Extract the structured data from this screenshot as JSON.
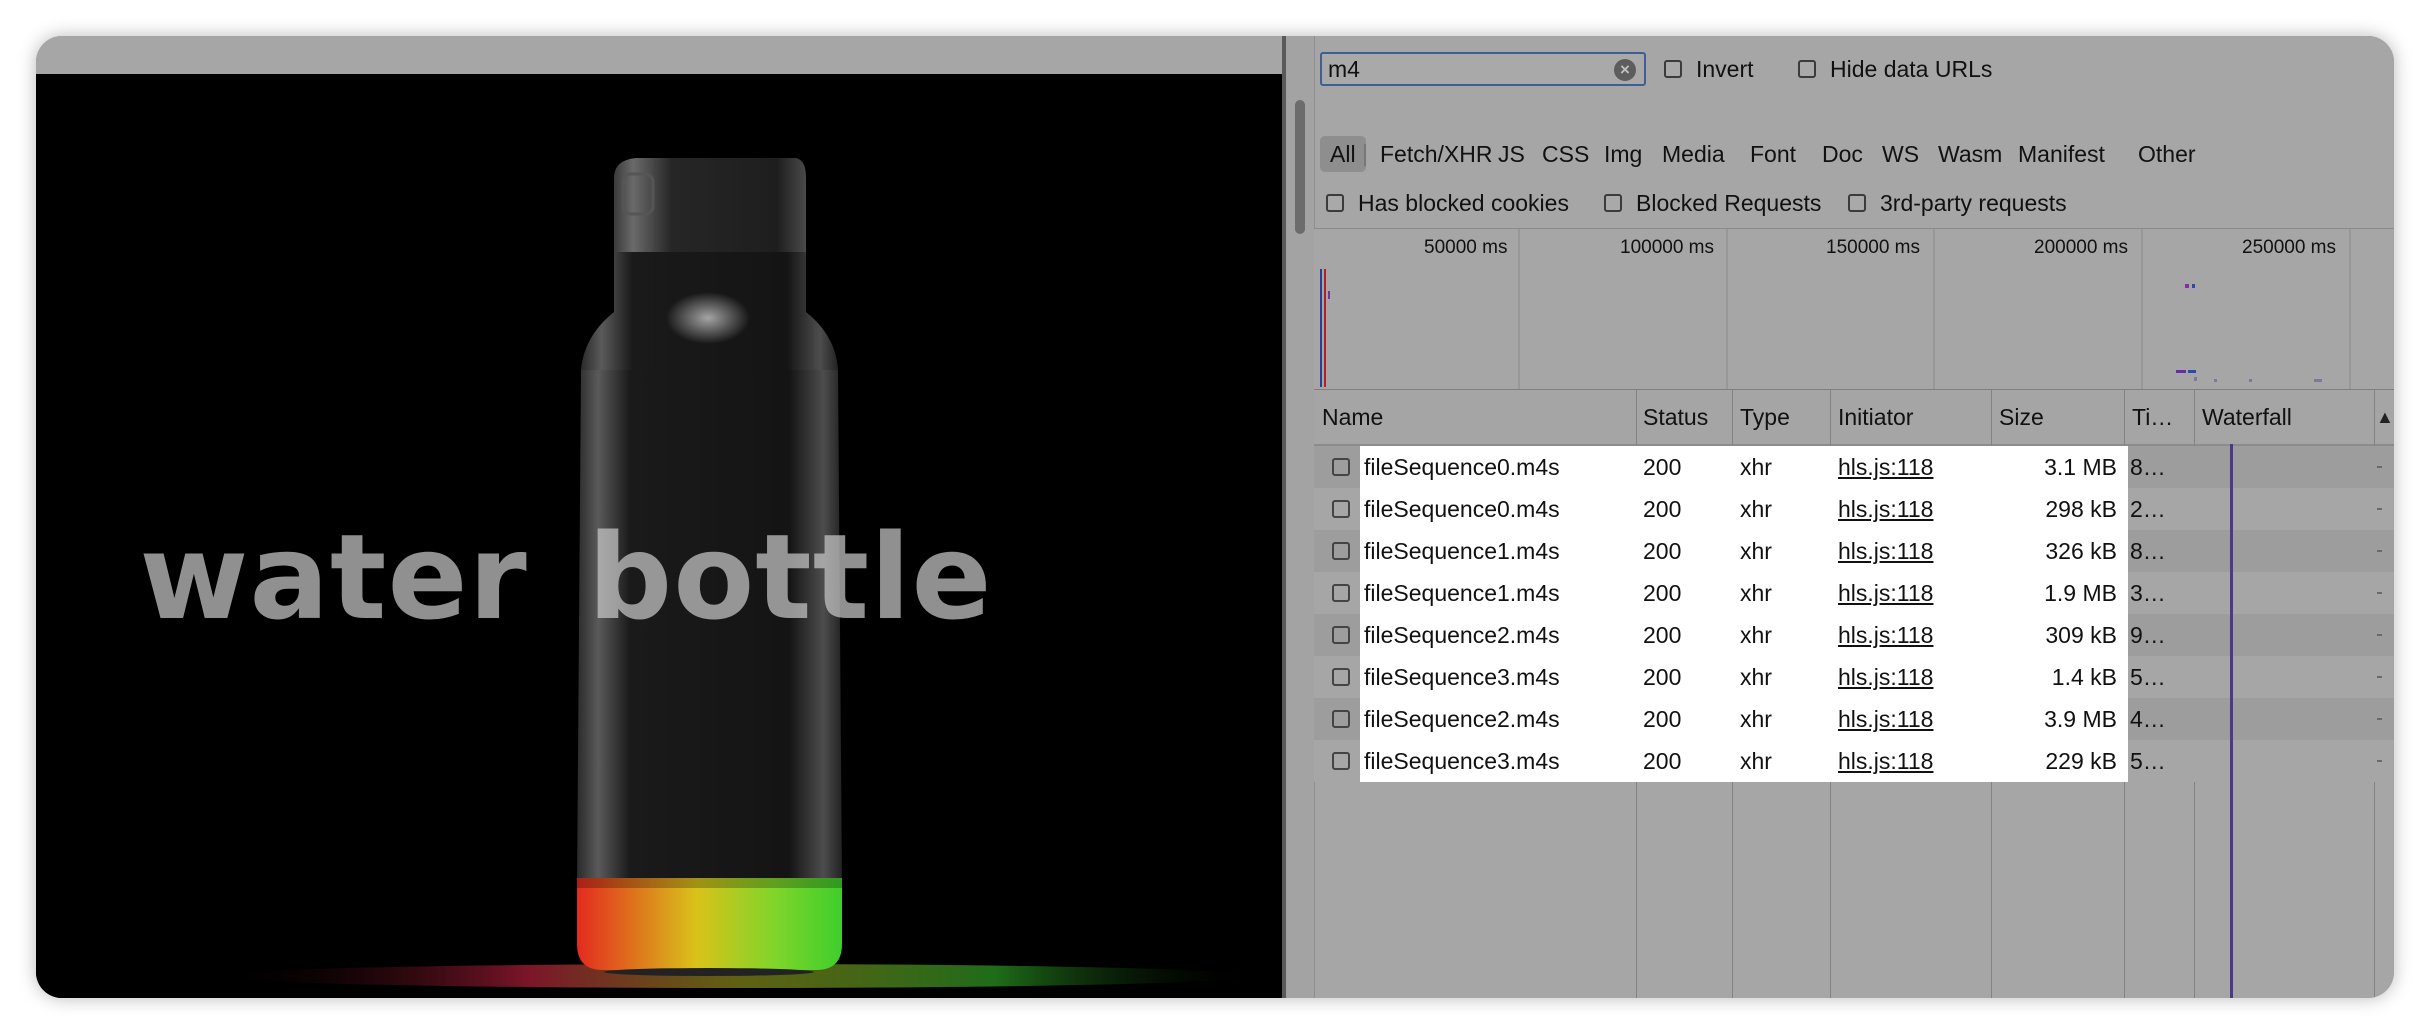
{
  "video": {
    "overlay_text": "water bottle",
    "colors": {
      "background": "#000000",
      "glow_red": "#e32b1f",
      "glow_yellow": "#d9c21a",
      "glow_green": "#3fce2c"
    }
  },
  "devtools": {
    "filter": {
      "value": "m4",
      "clear_icon": "clear-circle-icon"
    },
    "checkboxes_row1": [
      {
        "label": "Invert",
        "checked": false
      },
      {
        "label": "Hide data URLs",
        "checked": false
      }
    ],
    "type_filters": [
      "All",
      "Fetch/XHR",
      "JS",
      "CSS",
      "Img",
      "Media",
      "Font",
      "Doc",
      "WS",
      "Wasm",
      "Manifest",
      "Other"
    ],
    "selected_type_filter": "All",
    "checkboxes_row3": [
      {
        "label": "Has blocked cookies",
        "checked": false
      },
      {
        "label": "Blocked Requests",
        "checked": false
      },
      {
        "label": "3rd-party requests",
        "checked": false
      }
    ],
    "overview_ticks": [
      "50000 ms",
      "100000 ms",
      "150000 ms",
      "200000 ms",
      "250000 ms"
    ],
    "table": {
      "columns": [
        "Name",
        "Status",
        "Type",
        "Initiator",
        "Size",
        "Ti…",
        "Waterfall"
      ],
      "sort_icon": "sort-ascending-icon",
      "rows": [
        {
          "name": "fileSequence0.m4s",
          "status": "200",
          "type": "xhr",
          "initiator": "hls.js:118",
          "size": "3.1 MB",
          "time": "8…"
        },
        {
          "name": "fileSequence0.m4s",
          "status": "200",
          "type": "xhr",
          "initiator": "hls.js:118",
          "size": "298 kB",
          "time": "2…"
        },
        {
          "name": "fileSequence1.m4s",
          "status": "200",
          "type": "xhr",
          "initiator": "hls.js:118",
          "size": "326 kB",
          "time": "8…"
        },
        {
          "name": "fileSequence1.m4s",
          "status": "200",
          "type": "xhr",
          "initiator": "hls.js:118",
          "size": "1.9 MB",
          "time": "3…"
        },
        {
          "name": "fileSequence2.m4s",
          "status": "200",
          "type": "xhr",
          "initiator": "hls.js:118",
          "size": "309 kB",
          "time": "9…"
        },
        {
          "name": "fileSequence3.m4s",
          "status": "200",
          "type": "xhr",
          "initiator": "hls.js:118",
          "size": "1.4 kB",
          "time": "5…"
        },
        {
          "name": "fileSequence2.m4s",
          "status": "200",
          "type": "xhr",
          "initiator": "hls.js:118",
          "size": "3.9 MB",
          "time": "4…"
        },
        {
          "name": "fileSequence3.m4s",
          "status": "200",
          "type": "xhr",
          "initiator": "hls.js:118",
          "size": "229 kB",
          "time": "5…"
        }
      ]
    },
    "colors": {
      "focus_border": "#3d5f93",
      "row_highlight": "#ffffff",
      "waterfall_line": "#4b3a8c"
    }
  }
}
